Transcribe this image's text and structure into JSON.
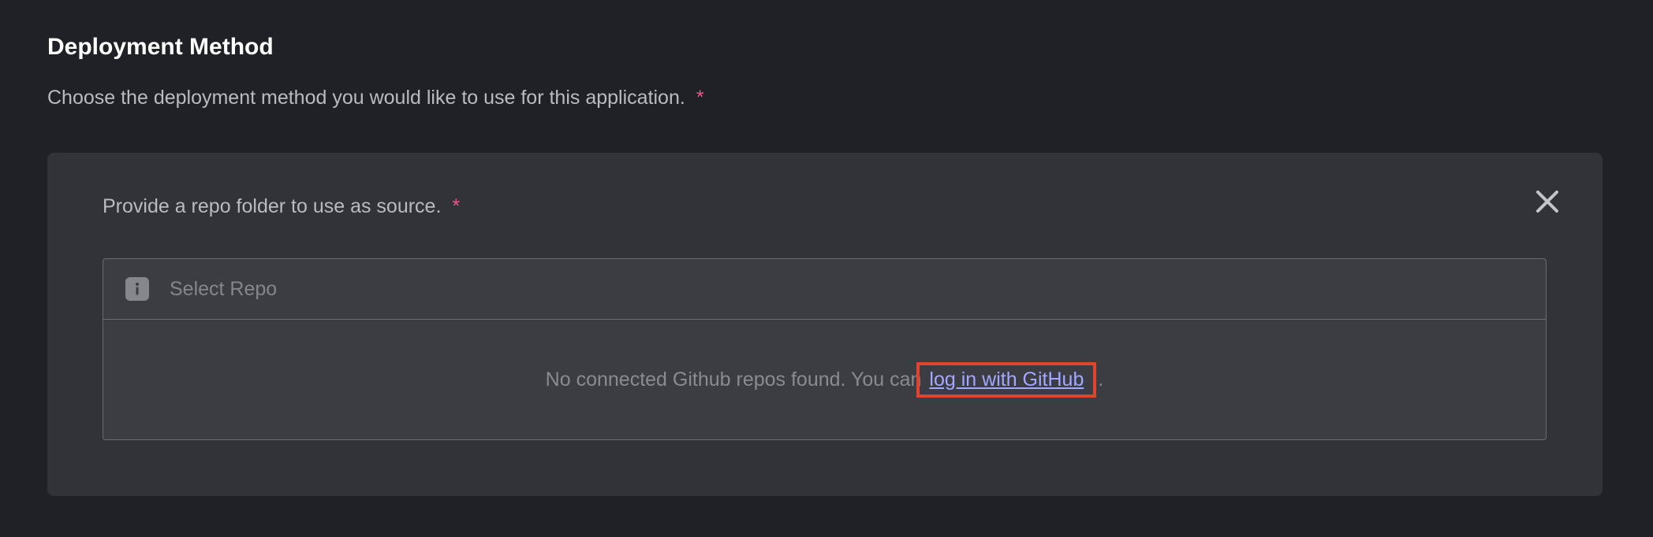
{
  "section": {
    "title": "Deployment Method",
    "description": "Choose the deployment method you would like to use for this application.",
    "required_mark": "*"
  },
  "source_card": {
    "label": "Provide a repo folder to use as source.",
    "required_mark": "*",
    "close_icon": "close-icon",
    "repo_select": {
      "icon": "info-icon",
      "placeholder": "Select Repo",
      "empty_message": "No connected Github repos found. You can",
      "login_link": "log in with GitHub",
      "trailing": "."
    }
  },
  "colors": {
    "background": "#202126",
    "card": "#323338",
    "required": "#e55a87",
    "link": "#a3a7ff",
    "highlight": "#e0442e"
  }
}
